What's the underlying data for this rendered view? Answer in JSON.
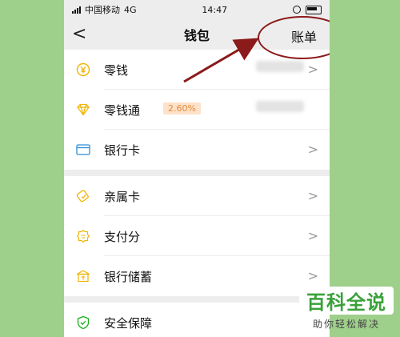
{
  "status_bar": {
    "carrier": "中国移动",
    "network": "4G",
    "time": "14:47"
  },
  "nav": {
    "back_glyph": "<",
    "title": "钱包",
    "action_label": "账单"
  },
  "groups": [
    [
      {
        "name": "wallet-change",
        "icon": "yuan-coin-icon",
        "label": "零钱"
      },
      {
        "name": "wallet-licaitong",
        "icon": "diamond-icon",
        "label": "零钱通",
        "badge": "2.60%"
      },
      {
        "name": "wallet-bank-card",
        "icon": "card-icon",
        "label": "银行卡"
      }
    ],
    [
      {
        "name": "family-card",
        "icon": "family-card-icon",
        "label": "亲属卡"
      },
      {
        "name": "payment-score",
        "icon": "score-icon",
        "label": "支付分"
      },
      {
        "name": "bank-savings",
        "icon": "bank-icon",
        "label": "银行储蓄"
      }
    ],
    [
      {
        "name": "security",
        "icon": "shield-icon",
        "label": "安全保障"
      }
    ]
  ],
  "watermark": {
    "title": "百科全说",
    "subtitle": "助你轻松解决"
  },
  "colors": {
    "icon_accent": "#f0b400",
    "annotation": "#8b1a1a",
    "page_bg": "#ededed",
    "side_bg": "#9ed08b",
    "watermark_green": "#3aa13a"
  }
}
